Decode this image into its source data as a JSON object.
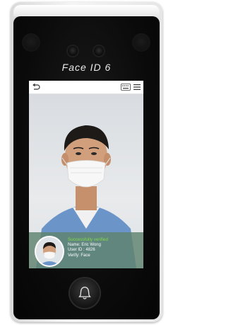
{
  "device": {
    "brand": "Face ID 6",
    "icons": [
      "proximity-sensor-icon",
      "camera-icon",
      "doorbell-icon"
    ]
  },
  "screen": {
    "toolbar": {
      "icons": [
        "back-icon",
        "keyboard-icon",
        "menu-icon"
      ]
    },
    "result": {
      "status": "Successfully verified",
      "name_line": "Name: Eric Wong",
      "userid_line": "User ID :  4826",
      "verify_line": "Verify: Face"
    }
  },
  "colors": {
    "status_green": "#7fdc4a",
    "panel_overlay": "#5f826e"
  }
}
